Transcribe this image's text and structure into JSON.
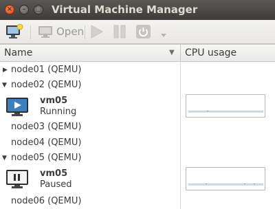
{
  "window": {
    "title": "Virtual Machine Manager"
  },
  "toolbar": {
    "open_label": "Open",
    "new_vm_icon": "new-vm-icon",
    "open_icon": "monitor-icon",
    "run_icon": "play-icon",
    "pause_icon": "pause-icon",
    "shutdown_icon": "power-icon",
    "dropdown_icon": "chevron-down-icon"
  },
  "table": {
    "columns": [
      "Name",
      "CPU usage"
    ],
    "rows": [
      {
        "type": "connection",
        "label": "node01 (QEMU)",
        "expanded": false
      },
      {
        "type": "connection",
        "label": "node02 (QEMU)",
        "expanded": true
      },
      {
        "type": "vm",
        "name": "vm05",
        "status": "Running",
        "icon": "running-vm-icon"
      },
      {
        "type": "connection",
        "label": "node03 (QEMU)",
        "expanded": null
      },
      {
        "type": "connection",
        "label": "node04 (QEMU)",
        "expanded": null
      },
      {
        "type": "connection",
        "label": "node05 (QEMU)",
        "expanded": true
      },
      {
        "type": "vm",
        "name": "vm05",
        "status": "Paused",
        "icon": "paused-vm-icon"
      },
      {
        "type": "connection",
        "label": "node06 (QEMU)",
        "expanded": null
      }
    ]
  },
  "colors": {
    "accent": "#dd4814",
    "graph_line": "#5a9bc4",
    "graph_fill": "#cfe3ef"
  }
}
